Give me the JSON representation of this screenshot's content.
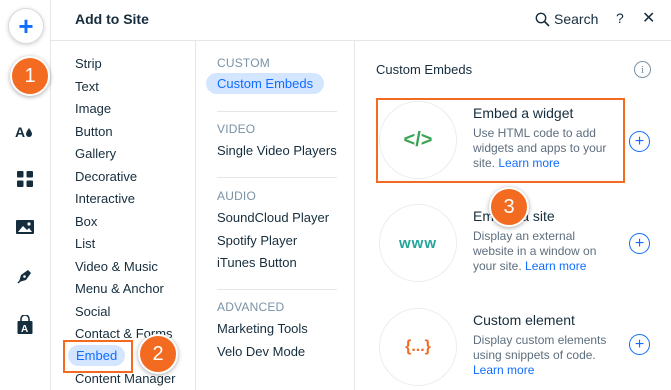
{
  "header": {
    "title": "Add to Site",
    "search_label": "Search",
    "help_label": "?",
    "close_label": "✕"
  },
  "rail": {
    "add_label": "+",
    "items": [
      "theme-icon",
      "apps-icon",
      "media-icon",
      "blog-icon",
      "store-icon"
    ]
  },
  "categories": [
    "Strip",
    "Text",
    "Image",
    "Button",
    "Gallery",
    "Decorative",
    "Interactive",
    "Box",
    "List",
    "Video & Music",
    "Menu & Anchor",
    "Social",
    "Contact & Forms",
    "Embed",
    "Content Manager"
  ],
  "active_category": "Embed",
  "sections": [
    {
      "head": "CUSTOM",
      "items": [
        "Custom Embeds"
      ]
    },
    {
      "head": "VIDEO",
      "items": [
        "Single Video Players"
      ]
    },
    {
      "head": "AUDIO",
      "items": [
        "SoundCloud Player",
        "Spotify Player",
        "iTunes Button"
      ]
    },
    {
      "head": "ADVANCED",
      "items": [
        "Marketing Tools",
        "Velo Dev Mode"
      ]
    }
  ],
  "panel": {
    "title": "Custom Embeds",
    "info_label": "i",
    "cards": [
      {
        "thumb": "</>",
        "thumb_color": "#3aa655",
        "title": "Embed a widget",
        "desc": "Use HTML code to add widgets and apps to your site.",
        "learn": "Learn more"
      },
      {
        "thumb": "www",
        "thumb_color": "#22a59b",
        "title": "Embed a site",
        "desc": "Display an external website in a window on your site.",
        "learn": "Learn more"
      },
      {
        "thumb": "{...}",
        "thumb_color": "#f26b21",
        "title": "Custom element",
        "desc": "Display custom elements using snippets of code.",
        "learn": "Learn more"
      }
    ],
    "add_label": "+"
  },
  "annotations": {
    "step1": "1",
    "step2": "2",
    "step3": "3",
    "color": "#f26b21"
  },
  "colors": {
    "accent": "#116dff",
    "selected_bg": "#d3e5ff",
    "annotation": "#f26b21"
  }
}
